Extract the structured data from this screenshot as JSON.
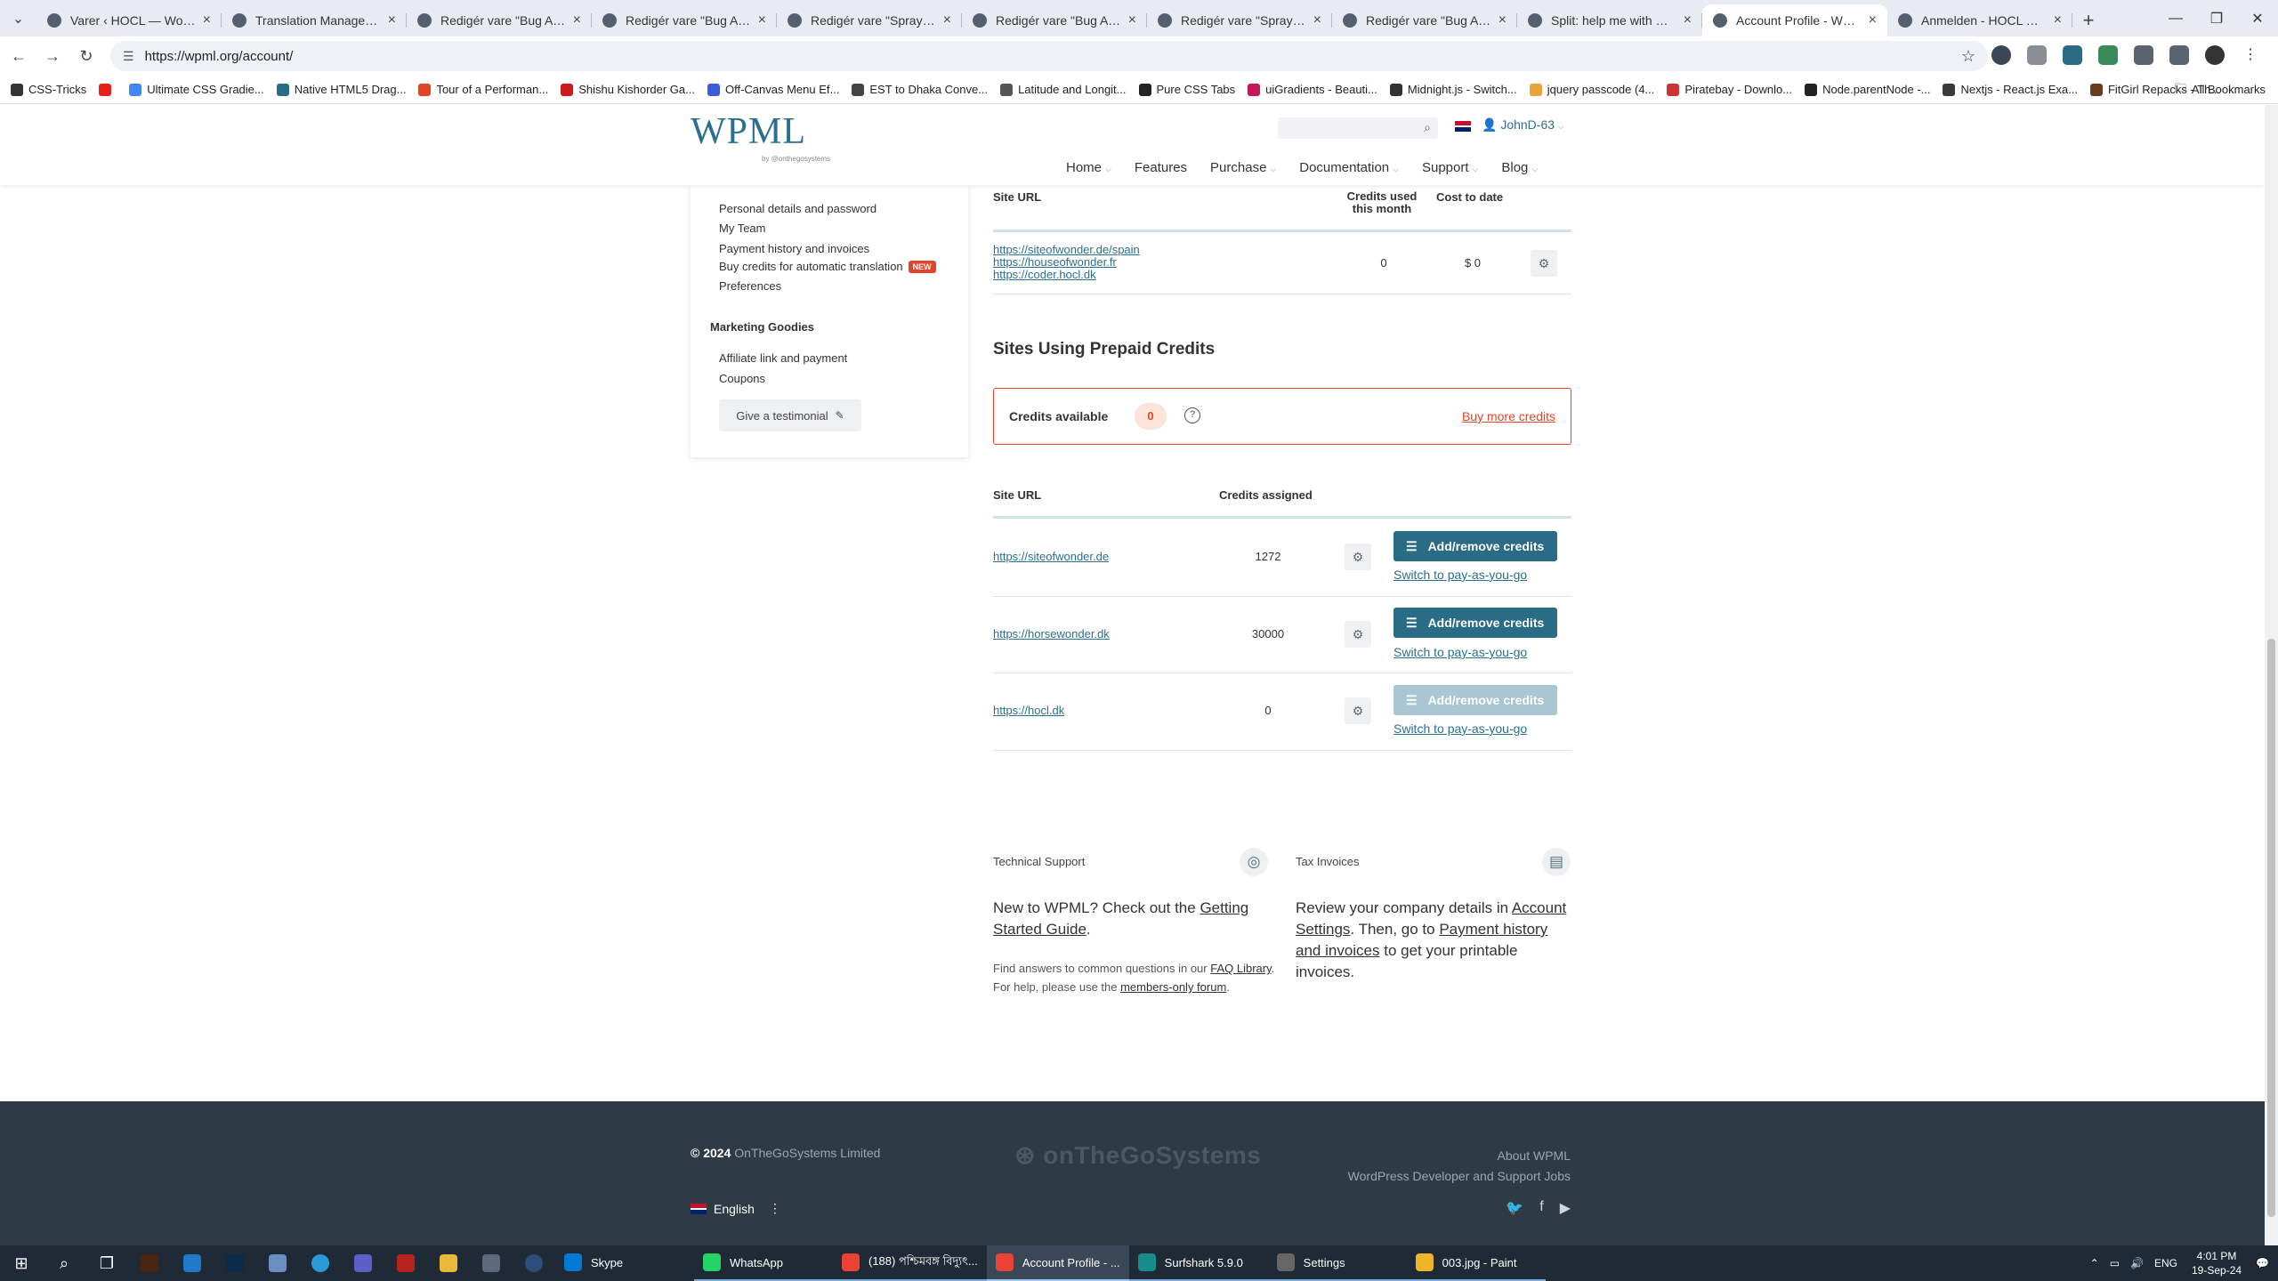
{
  "browser": {
    "tabs": [
      {
        "title": "Varer ‹ HOCL — WordPress",
        "active": false
      },
      {
        "title": "Translation Management",
        "active": false
      },
      {
        "title": "Redigér vare \"Bug Away S",
        "active": false
      },
      {
        "title": "Redigér vare \"Bug Away S",
        "active": false
      },
      {
        "title": "Redigér vare \"Spray anti-",
        "active": false
      },
      {
        "title": "Redigér vare \"Bug Away S",
        "active": false
      },
      {
        "title": "Redigér vare \"Spray Bug A",
        "active": false
      },
      {
        "title": "Redigér vare \"Bug Away R",
        "active": false
      },
      {
        "title": "Split: help me with my bil",
        "active": false
      },
      {
        "title": "Account Profile - WPML",
        "active": true
      },
      {
        "title": "Anmelden - HOCL — Wo",
        "active": false
      }
    ],
    "url": "https://wpml.org/account/",
    "bookmarks": [
      "CSS-Tricks",
      "",
      "Ultimate CSS Gradie...",
      "Native HTML5 Drag...",
      "Tour of a Performan...",
      "Shishu Kishorder Ga...",
      "Off-Canvas Menu Ef...",
      "EST to Dhaka Conve...",
      "Latitude and Longit...",
      "Pure CSS Tabs",
      "uiGradients - Beauti...",
      "Midnight.js - Switch...",
      "jquery passcode (4...",
      "Piratebay - Downlo...",
      "Node.parentNode -...",
      "Nextjs - React.js Exa...",
      "FitGirl Repacks - Th..."
    ],
    "all_bookmarks": "All Bookmarks"
  },
  "header": {
    "logo_text": "WPML",
    "logo_by": "by @onthegosystems",
    "user": "JohnD-63",
    "nav": [
      "Home",
      "Features",
      "Purchase",
      "Documentation",
      "Support",
      "Blog"
    ]
  },
  "sidebar": {
    "account_links": [
      "Personal details and password",
      "My Team",
      "Payment history and invoices",
      "Buy credits for automatic translation",
      "Preferences"
    ],
    "new_badge": "NEW",
    "marketing_heading": "Marketing Goodies",
    "marketing_links": [
      "Affiliate link and payment",
      "Coupons"
    ],
    "testimonial_button": "Give a testimonial"
  },
  "payg": {
    "col_site_url": "Site URL",
    "col_credits_used": "Credits used this month",
    "col_cost": "Cost to date",
    "sites": [
      "https://siteofwonder.de/spain",
      "https://houseofwonder.fr",
      "https://coder.hocl.dk"
    ],
    "credits_used": "0",
    "cost": "$ 0"
  },
  "prepaid": {
    "title": "Sites Using Prepaid Credits",
    "credits_available_label": "Credits available",
    "credits_available": "0",
    "buy_more": "Buy more credits",
    "col_site_url": "Site URL",
    "col_credits_assigned": "Credits assigned",
    "rows": [
      {
        "url": "https://siteofwonder.de",
        "credits": "1272",
        "button": "Add/remove credits",
        "switch": "Switch to pay-as-you-go"
      },
      {
        "url": "https://horsewonder.dk",
        "credits": "30000",
        "button": "Add/remove credits",
        "switch": "Switch to pay-as-you-go"
      },
      {
        "url": "https://hocl.dk",
        "credits": "0",
        "button": "Add/remove credits",
        "switch": "Switch to pay-as-you-go"
      }
    ]
  },
  "support": {
    "tech_title": "Technical Support",
    "tech_big_1": "New to WPML? Check out the ",
    "tech_big_link": "Getting Started Guide",
    "tech_big_2": ".",
    "tech_small_1": "Find answers to common questions in our ",
    "tech_small_link1": "FAQ Library",
    "tech_small_2": ". For help, please use the ",
    "tech_small_link2": "members-only forum",
    "tech_small_3": ".",
    "tax_title": "Tax Invoices",
    "tax_1": "Review your company details in ",
    "tax_link1": "Account Settings",
    "tax_2": ". Then, go to ",
    "tax_link2": "Payment history and invoices",
    "tax_3": " to get your printable invoices."
  },
  "footer": {
    "copyright_year": "© 2024",
    "company": "OnTheGoSystems Limited",
    "brand": "onTheGoSystems",
    "links": [
      "About WPML",
      "WordPress Developer and Support Jobs"
    ],
    "language": "English"
  },
  "taskbar": {
    "apps": [
      {
        "label": "Skype",
        "state": "none"
      },
      {
        "label": "WhatsApp",
        "state": "running"
      },
      {
        "label": "(188) পশ্চিমবঙ্গ বিদ্যুৎ...",
        "state": "running"
      },
      {
        "label": "Account Profile - ...",
        "state": "active"
      },
      {
        "label": "Surfshark 5.9.0",
        "state": "running"
      },
      {
        "label": "Settings",
        "state": "running"
      },
      {
        "label": "003.jpg - Paint",
        "state": "running"
      }
    ],
    "lang": "ENG",
    "time": "4:01 PM",
    "date": "19-Sep-24"
  }
}
